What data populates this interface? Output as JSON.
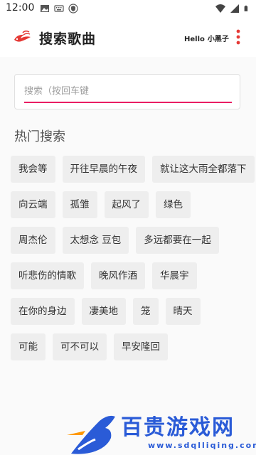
{
  "status_bar": {
    "time": "12:00",
    "icons_left": [
      "image-icon",
      "keyboard-icon",
      "shield-icon"
    ],
    "icons_right": [
      "wifi-icon",
      "signal-icon",
      "battery-icon"
    ]
  },
  "app_bar": {
    "title": "搜索歌曲",
    "greeting": "Hello",
    "user_name": "小黑子",
    "logo_icon": "bird-logo-icon",
    "menu_icon": "more-vert-icon",
    "accent_color": "#e53935"
  },
  "search": {
    "placeholder": "搜索（按回车键",
    "value": "",
    "underline_color": "#e91e63"
  },
  "hot_search": {
    "title": "热门搜索",
    "rows": [
      [
        "我会等",
        "开往早晨的午夜",
        "就让这大雨全都落下"
      ],
      [
        "向云端",
        "孤雏",
        "起风了",
        "绿色"
      ],
      [
        "周杰伦",
        "太想念 豆包",
        "多远都要在一起"
      ],
      [
        "听悲伤的情歌",
        "晚风作酒",
        "华晨宇"
      ],
      [
        "在你的身边",
        "凄美地",
        "笼",
        "晴天"
      ],
      [
        "可能",
        "可不可以",
        "早安隆回"
      ]
    ]
  },
  "watermark": {
    "text": "百贵游戏网",
    "url": "www.sdqlliqing.com",
    "color": "#2a5bd7"
  }
}
